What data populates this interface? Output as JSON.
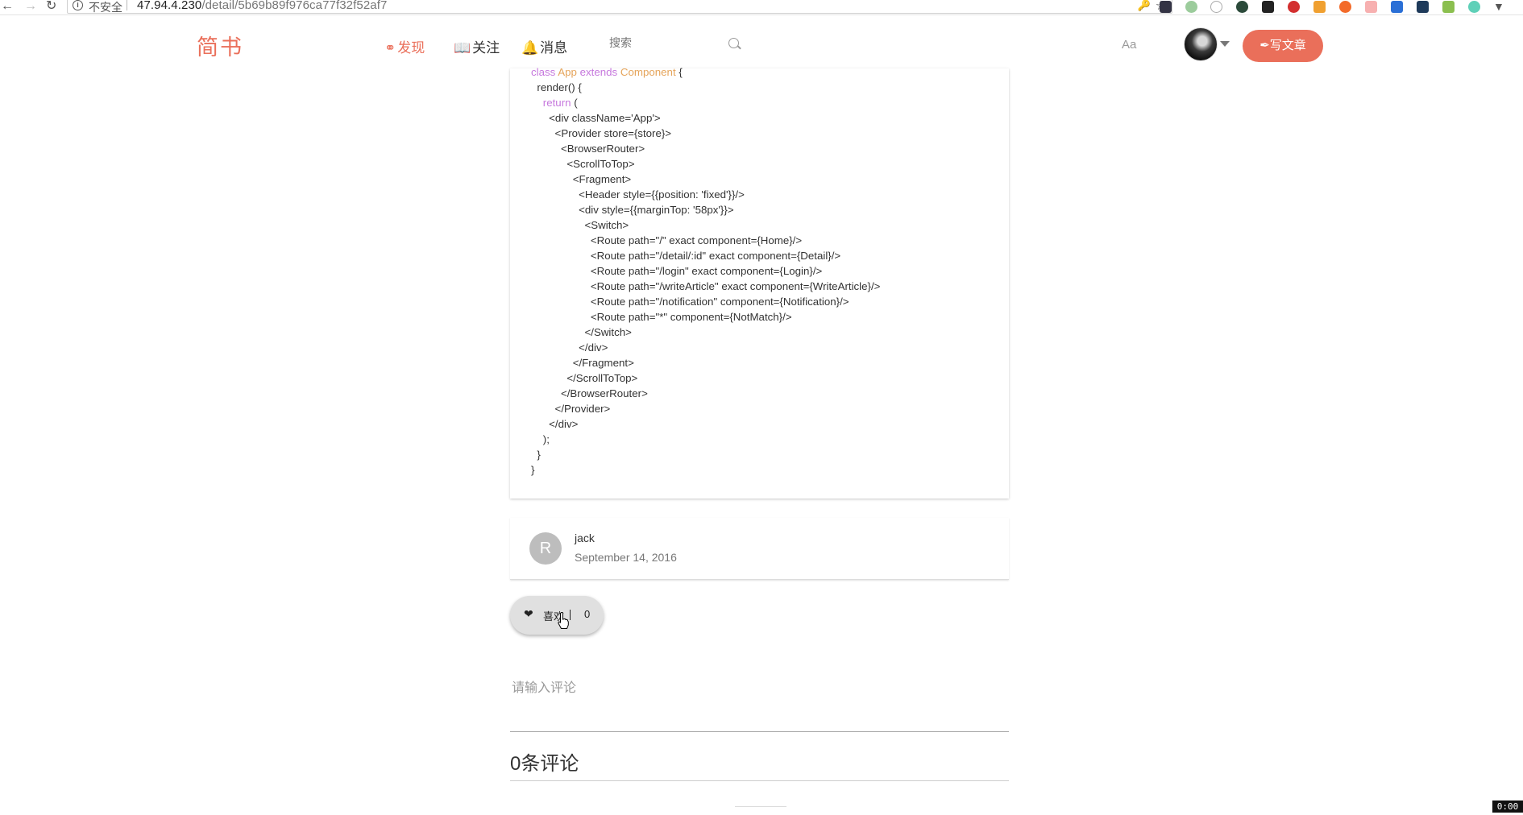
{
  "browser": {
    "security_label": "不安全",
    "url_host": "47.94.4.230",
    "url_path": "/detail/5b69b89f976ca77f32f52af7"
  },
  "header": {
    "logo": "简书",
    "nav": [
      {
        "label": "发现",
        "icon": "compass-icon",
        "active": true
      },
      {
        "label": "关注",
        "icon": "book-icon",
        "active": false
      },
      {
        "label": "消息",
        "icon": "bell-icon",
        "active": false
      }
    ],
    "search_placeholder": "搜索",
    "font_toggle": "Aa",
    "write_button": "写文章",
    "accent_color": "#ea6f5a"
  },
  "article": {
    "code_lines": [
      "class App extends Component {",
      "  render() {",
      "    return (",
      "      <div className='App'>",
      "        <Provider store={store}>",
      "          <BrowserRouter>",
      "            <ScrollToTop>",
      "              <Fragment>",
      "                <Header style={{position: 'fixed'}}/>",
      "                <div style={{marginTop: '58px'}}>",
      "                  <Switch>",
      "                    <Route path=\"/\" exact component={Home}/>",
      "                    <Route path=\"/detail/:id\" exact component={Detail}/>",
      "                    <Route path=\"/login\" exact component={Login}/>",
      "                    <Route path=\"/writeArticle\" exact component={WriteArticle}/>",
      "                    <Route path=\"/notification\" component={Notification}/>",
      "                    <Route path=\"*\" component={NotMatch}/>",
      "                  </Switch>",
      "                </div>",
      "              </Fragment>",
      "            </ScrollToTop>",
      "          </BrowserRouter>",
      "        </Provider>",
      "      </div>",
      "    );",
      "  }",
      "}"
    ]
  },
  "author": {
    "avatar_letter": "R",
    "name": "jack",
    "date": "September 14, 2016"
  },
  "like": {
    "label": "喜欢",
    "count": "0"
  },
  "comments": {
    "placeholder": "请输入评论",
    "count_label": "0条评论"
  },
  "overlay": {
    "timer": "0:00"
  }
}
